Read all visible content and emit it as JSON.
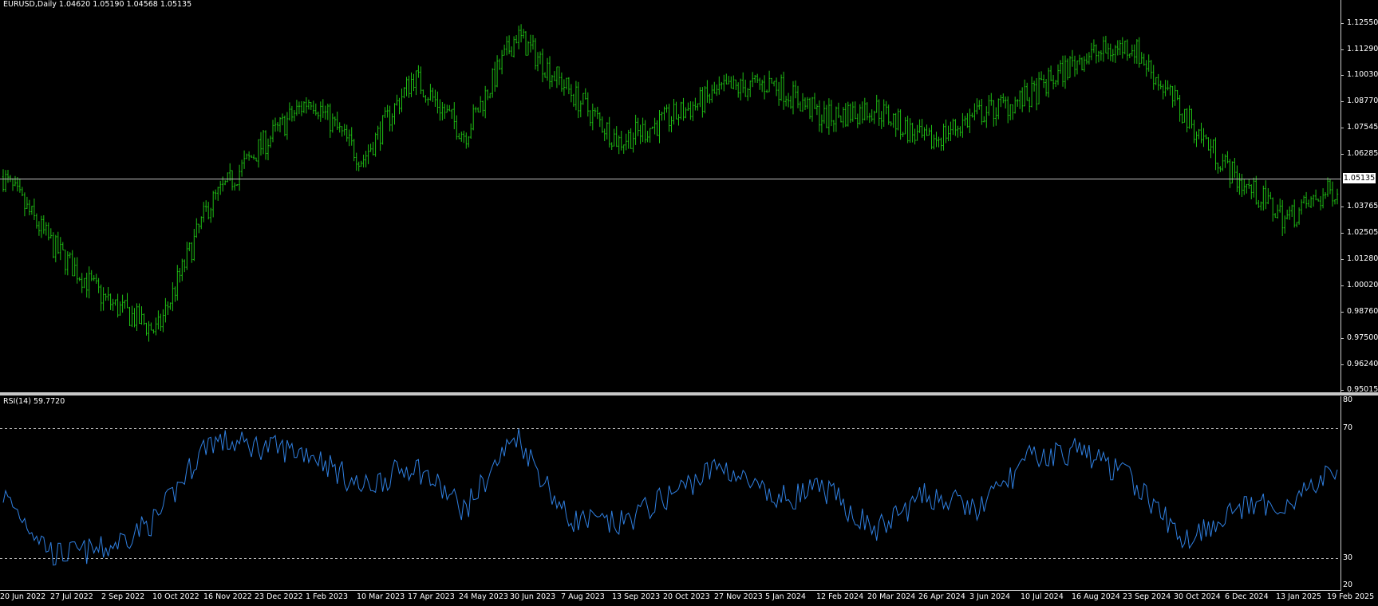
{
  "header": {
    "symbol_line": "EURUSD,Daily  1.04620 1.05190 1.04568 1.05135"
  },
  "rsi_header": {
    "label": "RSI(14) 59.7720"
  },
  "current_price": "1.05135",
  "colors": {
    "background": "#000000",
    "candles": "#1fbf14",
    "rsi_line": "#2f7fe0",
    "level_line": "#c0c0c0"
  },
  "price_axis": {
    "ticks": [
      "1.12550",
      "1.11290",
      "1.10030",
      "1.08770",
      "1.07545",
      "1.06285",
      "1.03765",
      "1.02505",
      "1.01280",
      "1.00020",
      "0.98760",
      "0.97500",
      "0.96240",
      "0.95015"
    ],
    "current_marker": "1.05135"
  },
  "rsi_axis": {
    "ticks": [
      "80",
      "70",
      "30",
      "20"
    ]
  },
  "date_axis": {
    "ticks": [
      "20 Jun 2022",
      "27 Jul 2022",
      "2 Sep 2022",
      "10 Oct 2022",
      "16 Nov 2022",
      "23 Dec 2022",
      "1 Feb 2023",
      "10 Mar 2023",
      "17 Apr 2023",
      "24 May 2023",
      "30 Jun 2023",
      "7 Aug 2023",
      "13 Sep 2023",
      "20 Oct 2023",
      "27 Nov 2023",
      "5 Jan 2024",
      "12 Feb 2024",
      "20 Mar 2024",
      "26 Apr 2024",
      "3 Jun 2024",
      "10 Jul 2024",
      "16 Aug 2024",
      "23 Sep 2024",
      "30 Oct 2024",
      "6 Dec 2024",
      "13 Jan 2025",
      "19 Feb 2025"
    ]
  },
  "chart_data": [
    {
      "type": "line",
      "title": "EURUSD,Daily",
      "x": [
        "20 Jun 2022",
        "27 Jul 2022",
        "2 Sep 2022",
        "10 Oct 2022",
        "16 Nov 2022",
        "23 Dec 2022",
        "1 Feb 2023",
        "10 Mar 2023",
        "17 Apr 2023",
        "24 May 2023",
        "30 Jun 2023",
        "7 Aug 2023",
        "13 Sep 2023",
        "20 Oct 2023",
        "27 Nov 2023",
        "5 Jan 2024",
        "12 Feb 2024",
        "20 Mar 2024",
        "26 Apr 2024",
        "3 Jun 2024",
        "10 Jul 2024",
        "16 Aug 2024",
        "23 Sep 2024",
        "30 Oct 2024",
        "6 Dec 2024",
        "13 Jan 2025",
        "19 Feb 2025"
      ],
      "series": [
        {
          "values": [
            1.052,
            1.018,
            0.993,
            0.978,
            1.038,
            1.066,
            1.09,
            1.06,
            1.1,
            1.072,
            1.12,
            1.094,
            1.069,
            1.08,
            1.093,
            1.097,
            1.08,
            1.085,
            1.068,
            1.082,
            1.09,
            1.109,
            1.115,
            1.082,
            1.052,
            1.032,
            1.047
          ]
        }
      ],
      "ylim": [
        0.95015,
        1.1255
      ],
      "horizontal_line": 1.05135
    },
    {
      "type": "line",
      "title": "RSI(14) 59.7720",
      "x": [
        "20 Jun 2022",
        "27 Jul 2022",
        "2 Sep 2022",
        "10 Oct 2022",
        "16 Nov 2022",
        "23 Dec 2022",
        "1 Feb 2023",
        "10 Mar 2023",
        "17 Apr 2023",
        "24 May 2023",
        "30 Jun 2023",
        "7 Aug 2023",
        "13 Sep 2023",
        "20 Oct 2023",
        "27 Nov 2023",
        "5 Jan 2024",
        "12 Feb 2024",
        "20 Mar 2024",
        "26 Apr 2024",
        "3 Jun 2024",
        "10 Jul 2024",
        "16 Aug 2024",
        "23 Sep 2024",
        "30 Oct 2024",
        "6 Dec 2024",
        "13 Jan 2025",
        "19 Feb 2025"
      ],
      "series": [
        {
          "values": [
            50,
            30,
            32,
            42,
            68,
            66,
            64,
            52,
            60,
            45,
            70,
            42,
            40,
            50,
            60,
            48,
            52,
            38,
            50,
            45,
            62,
            65,
            55,
            35,
            45,
            47,
            58
          ]
        }
      ],
      "ylim": [
        20,
        80
      ],
      "levels": [
        70,
        30
      ]
    }
  ]
}
